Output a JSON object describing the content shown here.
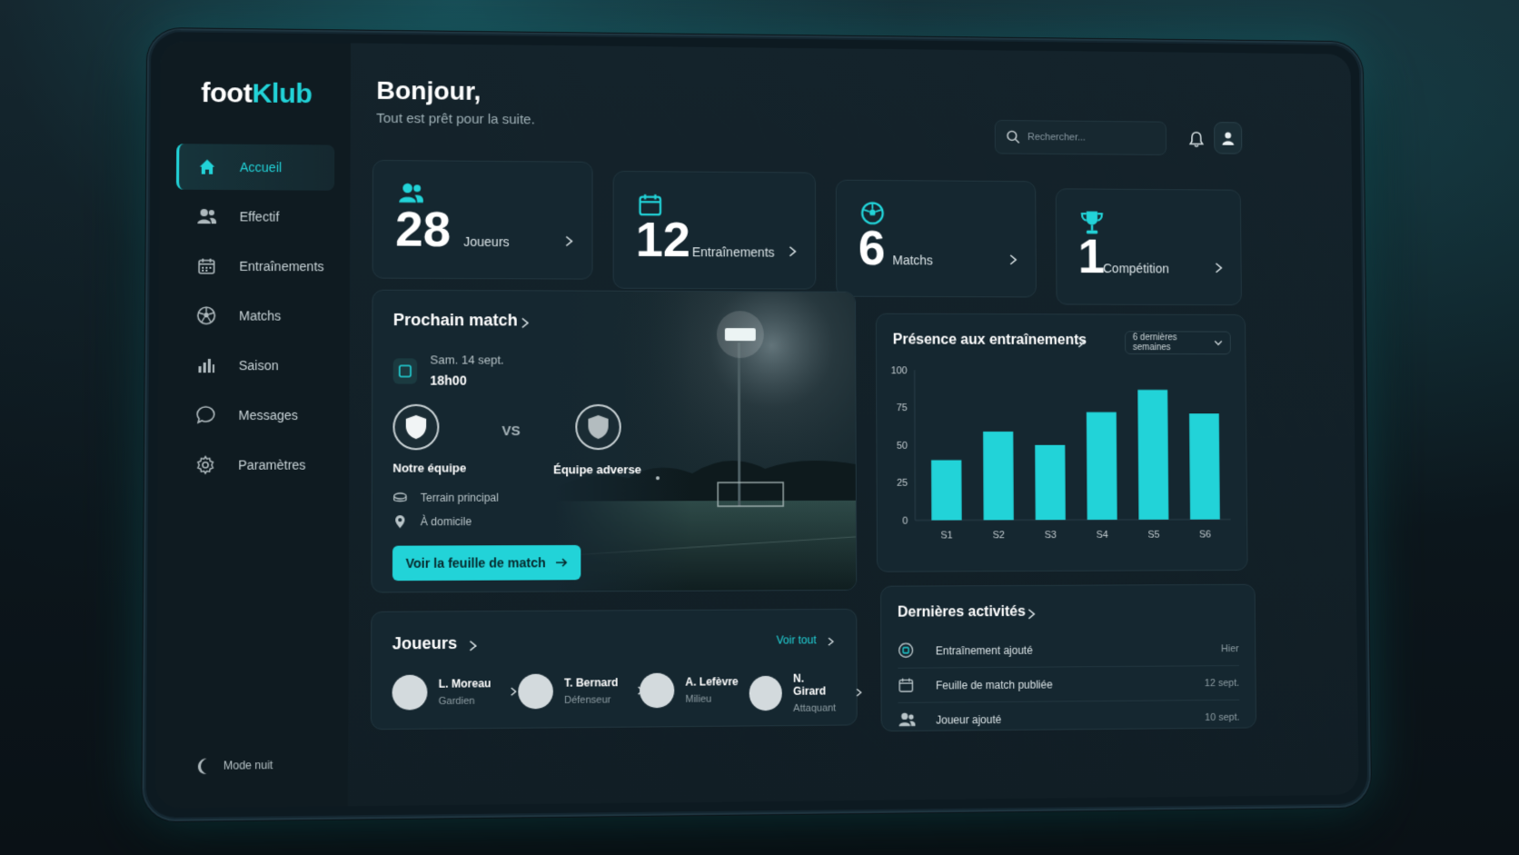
{
  "app": {
    "logo_part1": "foot",
    "logo_part2": "Klub"
  },
  "colors": {
    "accent": "#22d3d8",
    "background": "#111e25",
    "card": "#152730"
  },
  "sidebar": {
    "items": [
      {
        "label": "Accueil",
        "icon": "home-icon",
        "active": true
      },
      {
        "label": "Effectif",
        "icon": "users-icon"
      },
      {
        "label": "Entraînements",
        "icon": "calendar-icon"
      },
      {
        "label": "Matchs",
        "icon": "soccer-ball-icon"
      },
      {
        "label": "Saison",
        "icon": "bar-chart-icon"
      },
      {
        "label": "Messages",
        "icon": "chat-icon"
      },
      {
        "label": "Paramètres",
        "icon": "gear-icon"
      }
    ],
    "night_mode": "Mode nuit"
  },
  "header": {
    "greeting": "Bonjour,",
    "subtitle": "Tout est prêt pour la suite.",
    "search_placeholder": "Rechercher..."
  },
  "stats": [
    {
      "value": "28",
      "label": "Joueurs",
      "icon": "users-icon"
    },
    {
      "value": "12",
      "label": "Entraînements",
      "icon": "calendar-icon"
    },
    {
      "value": "6",
      "label": "Matchs",
      "icon": "soccer-ball-icon"
    },
    {
      "value": "1",
      "label": "Compétition",
      "icon": "trophy-icon"
    }
  ],
  "next_match": {
    "title": "Prochain match",
    "date": "Sam. 14 sept.",
    "time": "18h00",
    "home_team": "Notre équipe",
    "vs": "VS",
    "away_team": "Équipe adverse",
    "venue": "Terrain principal",
    "location": "À domicile",
    "cta": "Voir la feuille de match"
  },
  "players": {
    "title": "Joueurs",
    "see_all": "Voir tout",
    "list": [
      {
        "name": "L. Moreau",
        "role": "Gardien"
      },
      {
        "name": "T. Bernard",
        "role": "Défenseur"
      },
      {
        "name": "A. Lefèvre",
        "role": "Milieu"
      },
      {
        "name": "N. Girard",
        "role": "Attaquant"
      }
    ]
  },
  "presence": {
    "title": "Présence aux entraînements",
    "filter": "6 dernières semaines"
  },
  "chart_data": {
    "type": "bar",
    "categories": [
      "S1",
      "S2",
      "S3",
      "S4",
      "S5",
      "S6"
    ],
    "values": [
      40,
      59,
      50,
      72,
      87,
      71
    ],
    "yticks": [
      0,
      25,
      50,
      75,
      100
    ],
    "ylim": [
      0,
      100
    ],
    "grid": false,
    "color": "#22d3d8"
  },
  "activity": {
    "title": "Dernières activités",
    "items": [
      {
        "text": "Entraînement ajouté",
        "date": "Hier",
        "icon": "training-icon"
      },
      {
        "text": "Feuille de match publiée",
        "date": "12 sept.",
        "icon": "calendar-icon"
      },
      {
        "text": "Joueur ajouté",
        "date": "10 sept.",
        "icon": "user-add-icon"
      }
    ]
  }
}
